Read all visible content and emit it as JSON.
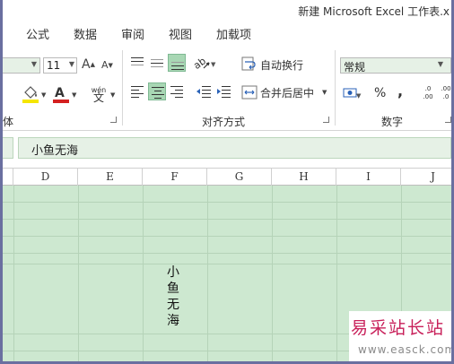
{
  "window": {
    "title": "新建 Microsoft Excel 工作表.x"
  },
  "ribbon_tabs": [
    {
      "label": "公式"
    },
    {
      "label": "数据"
    },
    {
      "label": "审阅"
    },
    {
      "label": "视图"
    },
    {
      "label": "加载项"
    }
  ],
  "font_group": {
    "font_size": "11",
    "group_label": "体"
  },
  "alignment_group": {
    "wrap_text_label": "自动换行",
    "merge_center_label": "合并后居中",
    "group_label": "对齐方式",
    "active_vertical_align": "bottom",
    "active_horizontal_align": "center"
  },
  "number_group": {
    "format_value": "常规",
    "group_label": "数字",
    "percent_symbol": "%",
    "comma_symbol": ",",
    "increase_decimal": "←.0 .00",
    "decrease_decimal": ".00 →.0"
  },
  "formula_bar": {
    "content": "小鱼无海"
  },
  "columns": [
    "D",
    "E",
    "F",
    "G",
    "H",
    "I",
    "J"
  ],
  "cells": {
    "F_vertical": "小鱼无海"
  },
  "watermark": {
    "title": "易采站长站",
    "url": "www.easck.com"
  },
  "colors": {
    "sheet_background": "#cde8d0",
    "gridline": "#b5d3b8",
    "pressed_button": "#a8d7b4",
    "frame_border": "#6a6fa0",
    "font_color_accent": "#d42020",
    "fill_color_accent": "#f5e600",
    "watermark_red": "#c8205a"
  }
}
